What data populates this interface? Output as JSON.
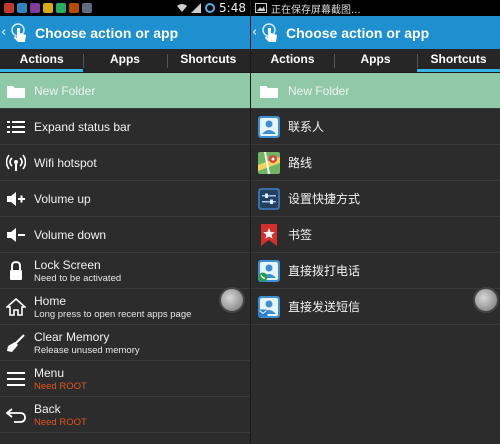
{
  "status_left": {
    "time": "5:48"
  },
  "status_right": {
    "text": "正在保存屏幕截图..."
  },
  "title": "Choose action or app",
  "tabs": [
    "Actions",
    "Apps",
    "Shortcuts"
  ],
  "actions": [
    {
      "label": "New Folder",
      "icon": "folder-icon"
    },
    {
      "label": "Expand status bar",
      "icon": "list-icon"
    },
    {
      "label": "Wifi hotspot",
      "icon": "wifi-hotspot-icon"
    },
    {
      "label": "Volume up",
      "icon": "volume-up-icon"
    },
    {
      "label": "Volume down",
      "icon": "volume-down-icon"
    },
    {
      "label": "Lock Screen",
      "sub": "Need to be activated",
      "icon": "lock-icon"
    },
    {
      "label": "Home",
      "sub": "Long press to open recent apps page",
      "icon": "home-icon"
    },
    {
      "label": "Clear Memory",
      "sub": "Release unused memory",
      "icon": "broom-icon"
    },
    {
      "label": "Menu",
      "sub": "Need ROOT",
      "icon": "menu-icon"
    },
    {
      "label": "Back",
      "sub": "Need ROOT",
      "icon": "back-arrow-icon"
    }
  ],
  "shortcuts": [
    {
      "label": "New Folder",
      "icon": "folder-icon"
    },
    {
      "label": "联系人",
      "icon": "contacts-icon"
    },
    {
      "label": "路线",
      "icon": "maps-icon"
    },
    {
      "label": "设置快捷方式",
      "icon": "settings-shortcut-icon"
    },
    {
      "label": "书签",
      "icon": "bookmark-icon"
    },
    {
      "label": "直接拨打电话",
      "icon": "direct-dial-icon"
    },
    {
      "label": "直接发送短信",
      "icon": "direct-message-icon"
    }
  ],
  "colors": {
    "accent": "#1e8fcf",
    "tab_indicator": "#33b5e5",
    "highlight_row": "#8fc9a8",
    "warning_text": "#e0541f"
  }
}
